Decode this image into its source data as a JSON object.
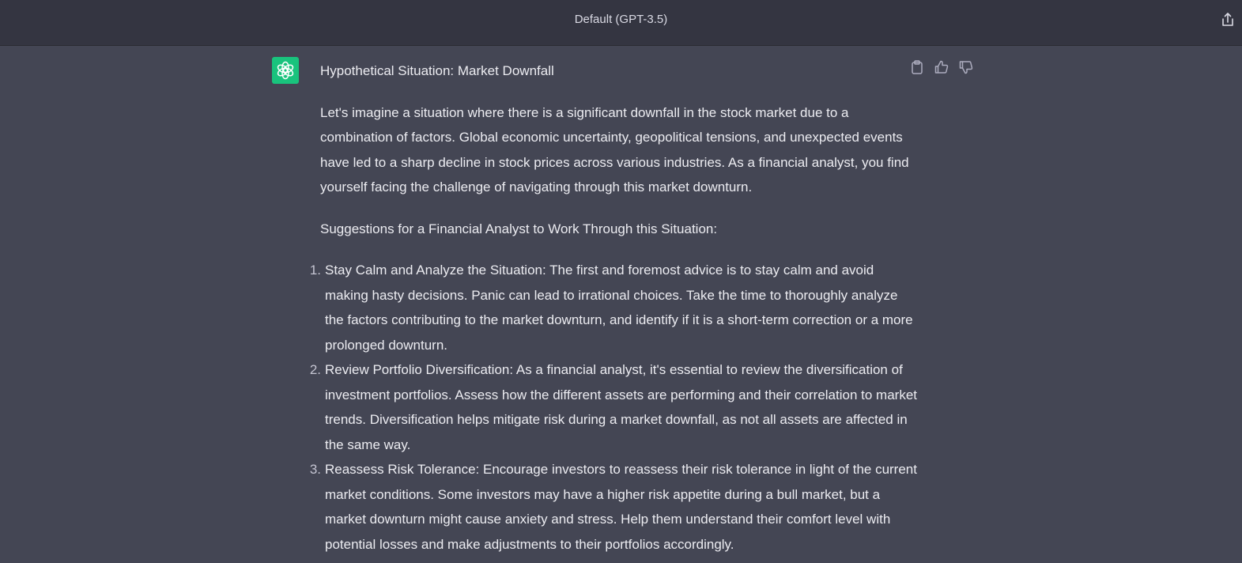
{
  "header": {
    "model_label": "Default (GPT-3.5)",
    "share_icon": "share-icon"
  },
  "message": {
    "avatar_icon": "openai-logo-icon",
    "avatar_color": "#19c37d",
    "actions": {
      "copy_icon": "clipboard-icon",
      "like_icon": "thumbs-up-icon",
      "dislike_icon": "thumbs-down-icon"
    },
    "title": "Hypothetical Situation: Market Downfall",
    "intro": "Let's imagine a situation where there is a significant downfall in the stock market due to a combination of factors. Global economic uncertainty, geopolitical tensions, and unexpected events have led to a sharp decline in stock prices across various industries. As a financial analyst, you find yourself facing the challenge of navigating through this market downturn.",
    "subheading": "Suggestions for a Financial Analyst to Work Through this Situation:",
    "items": [
      {
        "number": "1.",
        "text": "Stay Calm and Analyze the Situation: The first and foremost advice is to stay calm and avoid making hasty decisions. Panic can lead to irrational choices. Take the time to thoroughly analyze the factors contributing to the market downturn, and identify if it is a short-term correction or a more prolonged downturn."
      },
      {
        "number": "2.",
        "text": "Review Portfolio Diversification: As a financial analyst, it's essential to review the diversification of investment portfolios. Assess how the different assets are performing and their correlation to market trends. Diversification helps mitigate risk during a market downfall, as not all assets are affected in the same way."
      },
      {
        "number": "3.",
        "text": "Reassess Risk Tolerance: Encourage investors to reassess their risk tolerance in light of the current market conditions. Some investors may have a higher risk appetite during a bull market, but a market downturn might cause anxiety and stress. Help them understand their comfort level with potential losses and make adjustments to their portfolios accordingly."
      }
    ]
  }
}
